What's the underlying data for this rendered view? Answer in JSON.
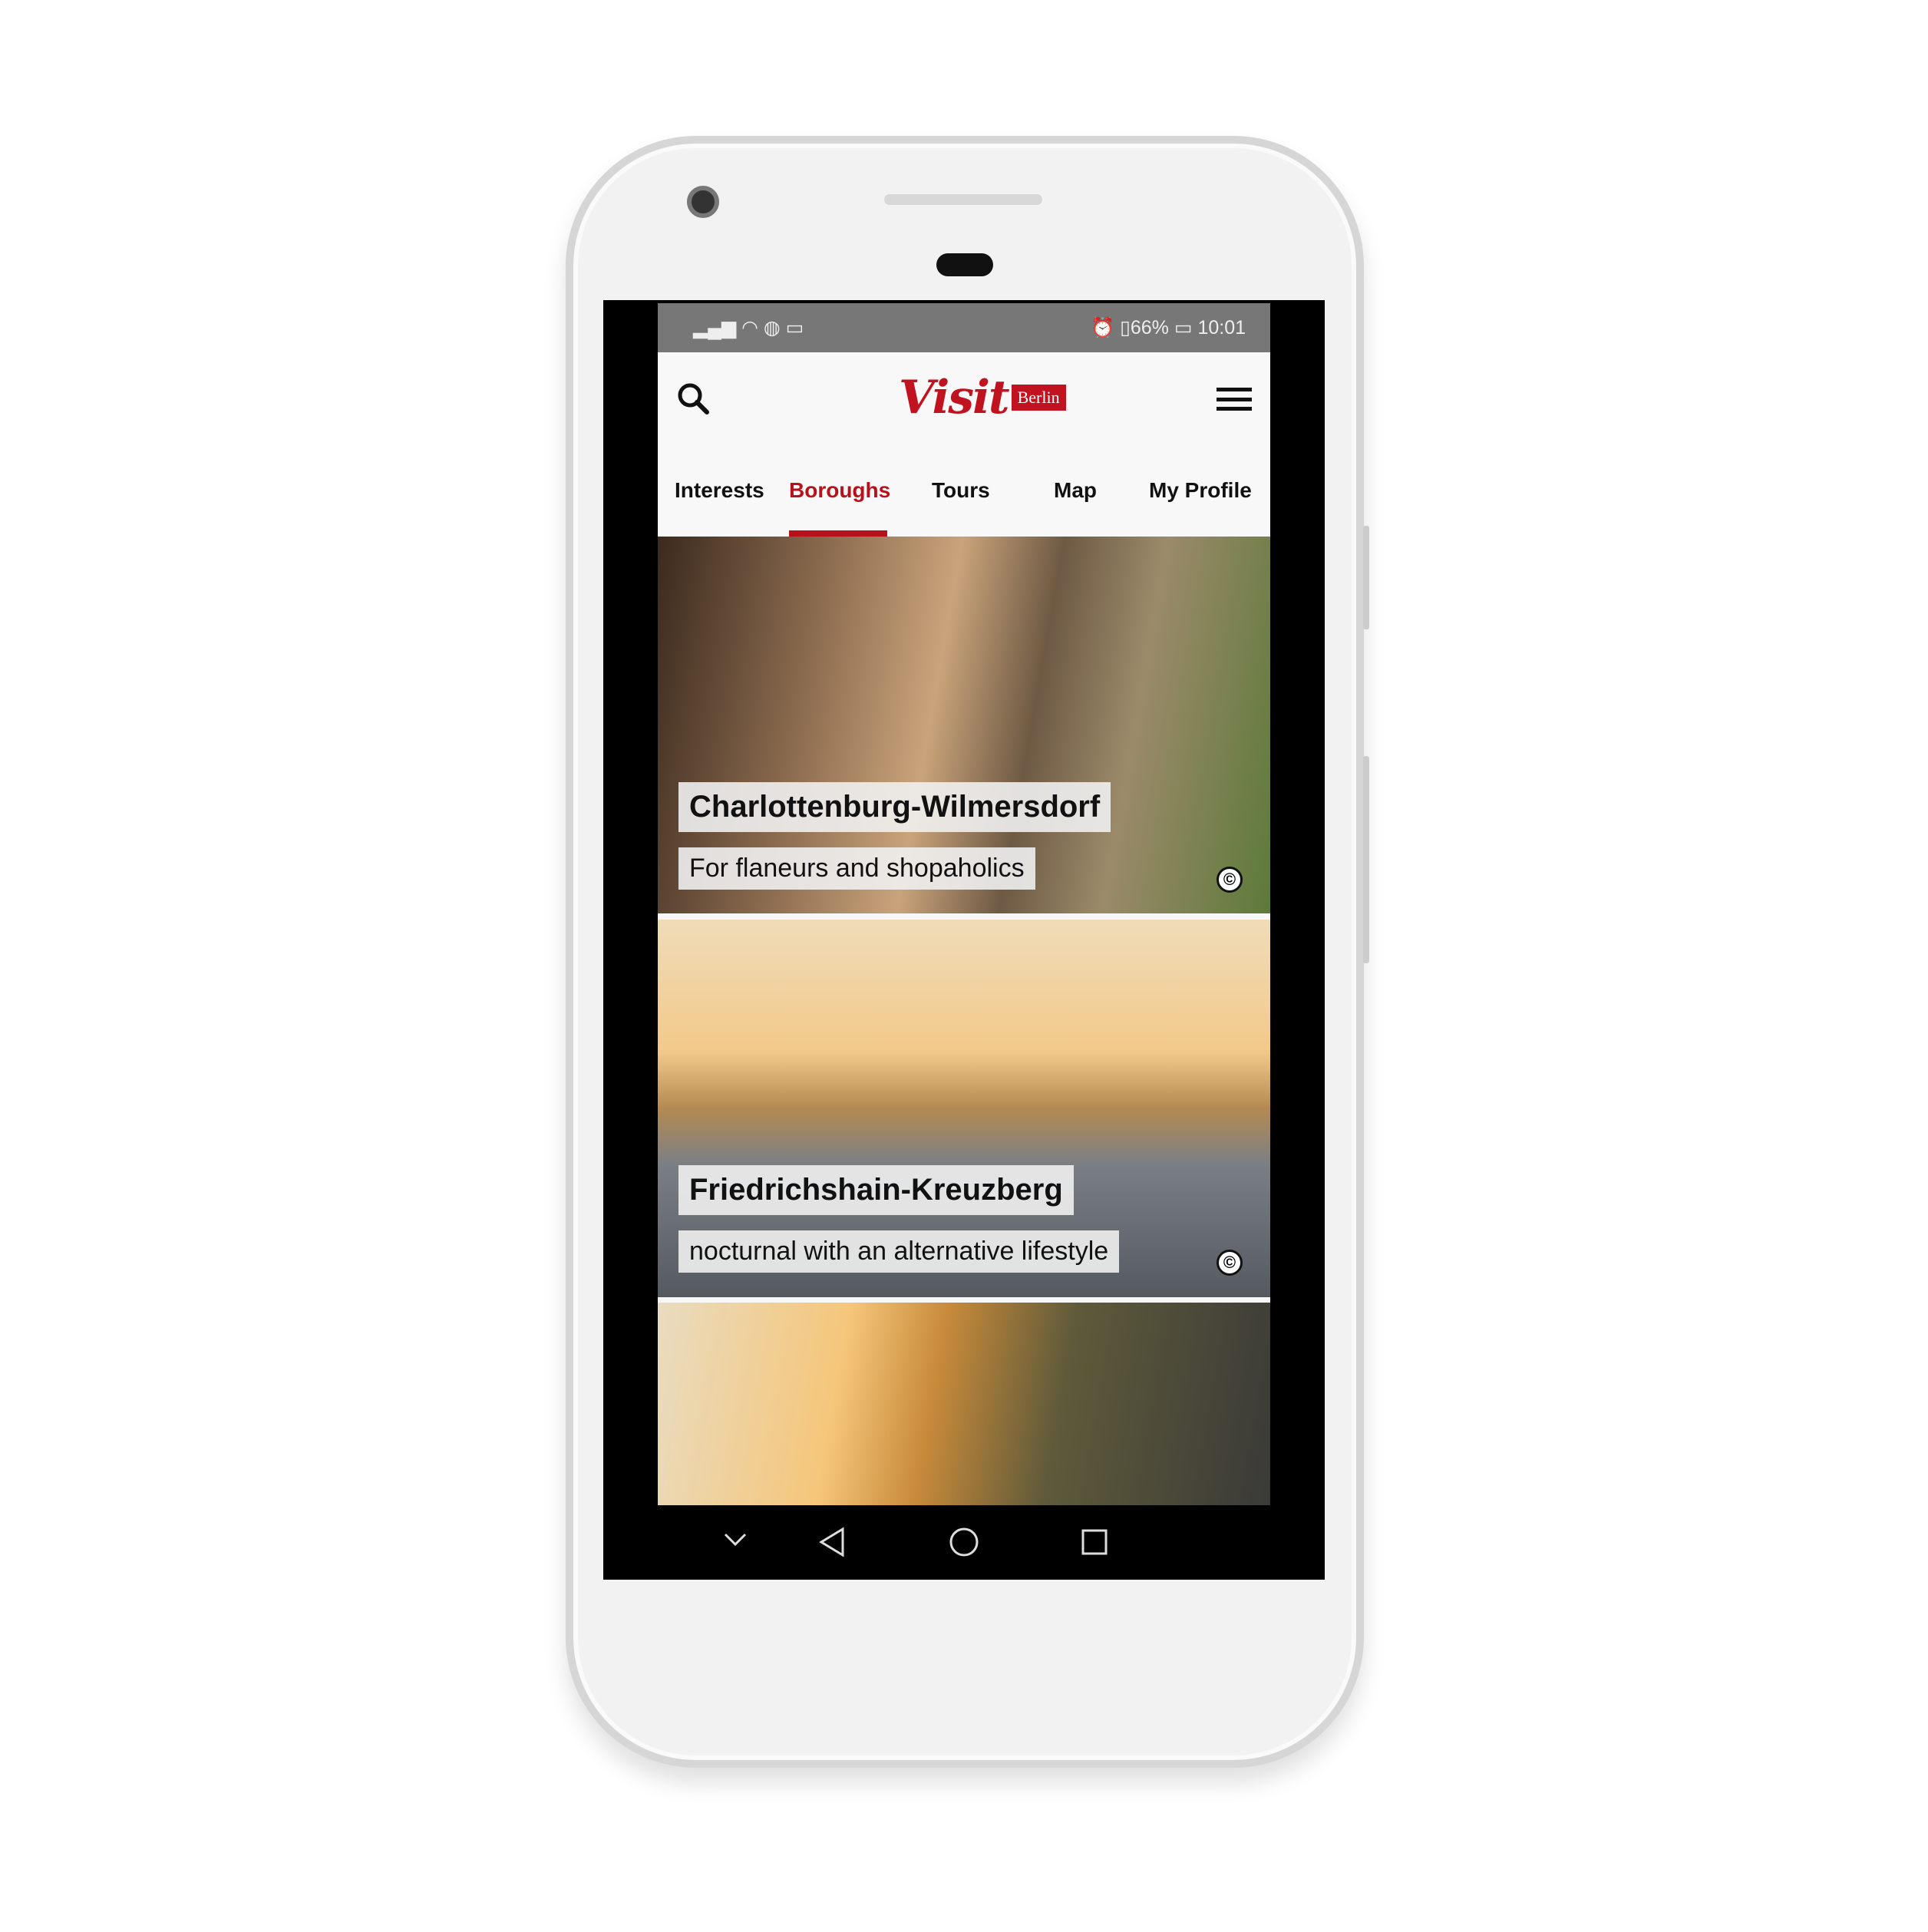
{
  "status_bar": {
    "battery": "66%",
    "time": "10:01"
  },
  "header": {
    "logo_script": "Visit",
    "logo_badge": "Berlin"
  },
  "tabs": [
    {
      "label": "Interests",
      "active": false
    },
    {
      "label": "Boroughs",
      "active": true
    },
    {
      "label": "Tours",
      "active": false
    },
    {
      "label": "Map",
      "active": false
    },
    {
      "label": "My Profile",
      "active": false
    }
  ],
  "cards": [
    {
      "title": "Charlottenburg-Wilmersdorf",
      "subtitle": "For flaneurs and shopaholics",
      "copyright": "©"
    },
    {
      "title": "Friedrichshain-Kreuzberg",
      "subtitle": "nocturnal with an alternative lifestyle",
      "copyright": "©"
    }
  ],
  "colors": {
    "accent": "#b5121b",
    "status_bar": "#777777"
  }
}
